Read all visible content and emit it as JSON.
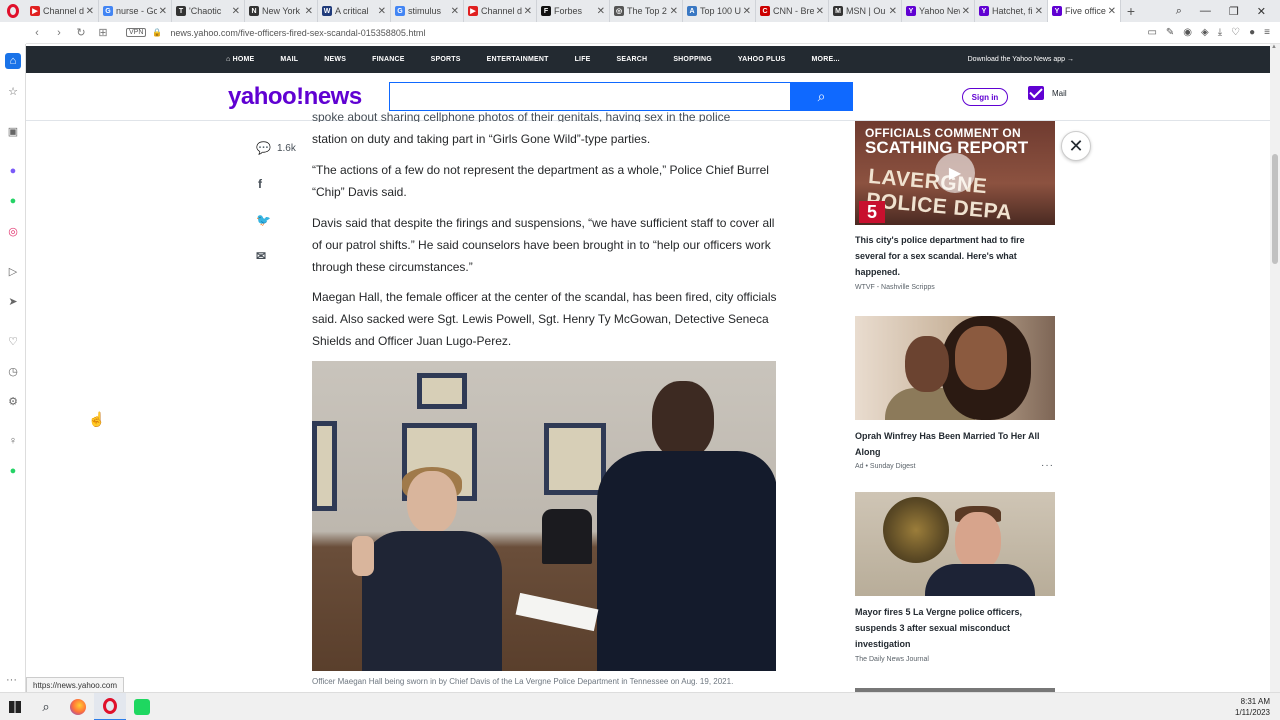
{
  "browser": {
    "tabs": [
      {
        "title": "Channel d",
        "fav_color": "#e02020",
        "fav_glyph": "▶"
      },
      {
        "title": "nurse - Go",
        "fav_color": "#4285f4",
        "fav_glyph": "G"
      },
      {
        "title": "'Chaotic",
        "fav_color": "#333333",
        "fav_glyph": "T"
      },
      {
        "title": "New York",
        "fav_color": "#333333",
        "fav_glyph": "N"
      },
      {
        "title": "A critical",
        "fav_color": "#1f3a7a",
        "fav_glyph": "W"
      },
      {
        "title": "stimulus",
        "fav_color": "#4285f4",
        "fav_glyph": "G"
      },
      {
        "title": "Channel d",
        "fav_color": "#e02020",
        "fav_glyph": "▶"
      },
      {
        "title": "Forbes",
        "fav_color": "#111111",
        "fav_glyph": "F"
      },
      {
        "title": "The Top 2",
        "fav_color": "#555555",
        "fav_glyph": "◎"
      },
      {
        "title": "Top 100 U",
        "fav_color": "#3a78c3",
        "fav_glyph": "A"
      },
      {
        "title": "CNN - Bre",
        "fav_color": "#cc0000",
        "fav_glyph": "C"
      },
      {
        "title": "MSN | Ou",
        "fav_color": "#333333",
        "fav_glyph": "M"
      },
      {
        "title": "Yahoo New",
        "fav_color": "#6001d2",
        "fav_glyph": "Y"
      },
      {
        "title": "Hatchet, fi",
        "fav_color": "#6001d2",
        "fav_glyph": "Y"
      },
      {
        "title": "Five office",
        "fav_color": "#6001d2",
        "fav_glyph": "Y"
      }
    ],
    "url": "news.yahoo.com/five-officers-fired-sex-scandal-015358805.html",
    "vpn_label": "VPN",
    "status_url": "https://news.yahoo.com"
  },
  "yahoo_nav": {
    "items": [
      "HOME",
      "MAIL",
      "NEWS",
      "FINANCE",
      "SPORTS",
      "ENTERTAINMENT",
      "LIFE",
      "SEARCH",
      "SHOPPING",
      "YAHOO PLUS",
      "MORE..."
    ],
    "download_text": "Download the Yahoo News app"
  },
  "header": {
    "logo": "yahoo!news",
    "search_placeholder": "",
    "signin": "Sign in",
    "mail": "Mail"
  },
  "article": {
    "cut_text": "spoke about sharing cellphone photos of their genitals, having sex in the police",
    "paragraphs": [
      "station on duty and taking part in “Girls Gone Wild”-type parties.",
      "“The actions of a few do not represent the department as a whole,” Police Chief Burrel “Chip” Davis said.",
      "Davis said that despite the firings and suspensions, “we have sufficient staff to cover all of our patrol shifts.” He said counselors have been brought in to “help our officers work through these circumstances.”",
      "Maegan Hall, the female officer at the center of the scandal, has been fired, city officials said. Also sacked were Sgt. Lewis Powell, Sgt. Henry Ty McGowan, Detective Seneca Shields and Officer Juan Lugo-Perez."
    ],
    "comment_count": "1.6k",
    "caption": "Officer Maegan Hall being sworn in by Chief Davis of the La Vergne Police Department in Tennessee on Aug. 19, 2021."
  },
  "rail": {
    "video": {
      "overlay_line1": "OFFICIALS COMMENT ON",
      "overlay_line2": "SCATHING REPORT",
      "overlay_line3": "LAVERGNE POLICE DEPA",
      "channel": "5",
      "title": "This city's police department had to fire several for a sex scandal. Here's what happened.",
      "source": "WTVF - Nashville Scripps"
    },
    "stories": [
      {
        "title": "Oprah Winfrey Has Been Married To Her All Along",
        "source": "Ad • Sunday Digest"
      },
      {
        "title": "Mayor fires 5 La Vergne police officers, suspends 3 after sexual misconduct investigation",
        "source": "The Daily News Journal"
      }
    ]
  },
  "taskbar": {
    "time": "8:31 AM",
    "date": "1/11/2023"
  },
  "colors": {
    "yahoo_purple": "#6001d2",
    "search_blue": "#0f69ff",
    "nav_bg": "#232a31"
  }
}
